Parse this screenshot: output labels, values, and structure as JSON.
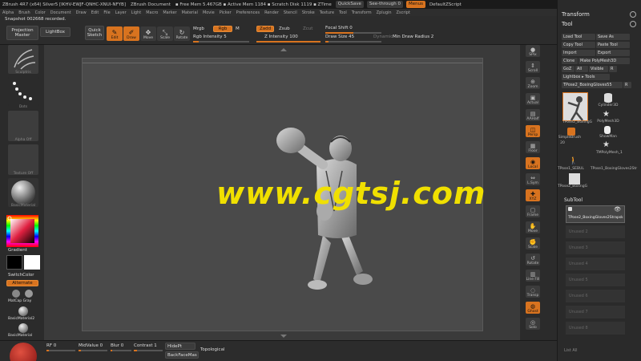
{
  "titlebar": {
    "app": "ZBrush 4R7 (x64) Silver5 [IKHV-EWJF-QNHC-XNUI-NFYB]",
    "doc": "ZBrush Document",
    "mem": "▪ Free Mem 5.467GB ▪ Active Mem 1184 ▪ Scratch Disk 1119 ▪ ZTime",
    "quicksave": "QuickSave",
    "seethrough": "See-through  0",
    "menus": "Menus",
    "script": "DefaultZScript"
  },
  "menu": [
    "Alpha",
    "Brush",
    "Color",
    "Document",
    "Draw",
    "Edit",
    "File",
    "Layer",
    "Light",
    "Macro",
    "Marker",
    "Material",
    "Movie",
    "Picker",
    "Preferences",
    "Render",
    "Stencil",
    "Stroke",
    "Texture",
    "Tool",
    "Transform",
    "Zplugin",
    "Zscript"
  ],
  "topshelf": {
    "note": "Snapshot 002668 recorded.",
    "projection": "Projection Master",
    "lightbox": "LightBox",
    "quicksketch": "Quick Sketch",
    "tools": [
      {
        "label": "Edit",
        "icon": "✎",
        "active": true
      },
      {
        "label": "Draw",
        "icon": "✐",
        "active": true
      },
      {
        "label": "Move",
        "icon": "✥",
        "active": false
      },
      {
        "label": "Scale",
        "icon": "⤡",
        "active": false
      },
      {
        "label": "Rotate",
        "icon": "↻",
        "active": false
      }
    ],
    "mrgb": "Mrgb",
    "rgb": "Rgb",
    "m": "M",
    "rgb_intensity": "Rgb Intensity 5",
    "zadd": "Zadd",
    "zsub": "Zsub",
    "zcut": "Zcut",
    "z_intensity": "Z Intensity 100",
    "focal_shift": "Focal Shift 0",
    "draw_size": "Draw Size 45",
    "dynamic": "Dynamic",
    "min_draw_radius": "Min Draw Radius 2"
  },
  "leftpanel": {
    "brush": "Sculptris",
    "stroke": "Dots",
    "alpha": "Alpha Off",
    "texture": "Texture Off",
    "material": "BasicMaterial",
    "gradient": "Gradient",
    "switchcolor": "SwitchColor",
    "alternate": "Alternate",
    "matcap": "MatCap Gray",
    "basicmat2": "BasicMaterial2",
    "basicmat": "BasicMaterial"
  },
  "bottombar": {
    "rf": "RF 0",
    "midvalue": "MidValue 0",
    "blur": "Blur 0",
    "contrast": "Contrast 1",
    "hidept": "HidePt",
    "backfacemas": "BackFaceMas",
    "topological": "Topological"
  },
  "righttools": [
    {
      "label": "SPix",
      "icon": "●",
      "active": false
    },
    {
      "label": "Scroll",
      "icon": "⇕",
      "active": false
    },
    {
      "label": "Zoom",
      "icon": "⊕",
      "active": false
    },
    {
      "label": "Actual",
      "icon": "▣",
      "active": false
    },
    {
      "label": "AAHalf",
      "icon": "▤",
      "active": false
    },
    {
      "label": "Persp",
      "icon": "◫",
      "active": true
    },
    {
      "label": "Floor",
      "icon": "▦",
      "active": false
    },
    {
      "label": "Local",
      "icon": "◉",
      "active": true
    },
    {
      "label": "L.Sym",
      "icon": "⇔",
      "active": false
    },
    {
      "label": "XYZ",
      "icon": "✚",
      "active": true
    },
    {
      "label": "Frame",
      "icon": "▢",
      "active": false
    },
    {
      "label": "Move",
      "icon": "✋",
      "active": false
    },
    {
      "label": "Scale",
      "icon": "✊",
      "active": false
    },
    {
      "label": "Rotate",
      "icon": "↺",
      "active": false
    },
    {
      "label": "Line Fill",
      "icon": "▥",
      "active": false
    },
    {
      "label": "Transp",
      "icon": "◌",
      "active": false
    },
    {
      "label": "Ghost",
      "icon": "◍",
      "active": true
    },
    {
      "label": "Solo",
      "icon": "◎",
      "active": false
    }
  ],
  "rightpanel": {
    "transform": "Transform",
    "tool": "Tool",
    "buttons": [
      [
        "Load Tool",
        "Save As"
      ],
      [
        "Copy Tool",
        "Paste Tool"
      ],
      [
        "Import",
        "Export"
      ],
      [
        "Clone",
        "Make PolyMesh3D"
      ],
      [
        "GoZ",
        "All",
        "Visible",
        "R"
      ]
    ],
    "lightbox_tools": "Lightbox ▸ Tools",
    "current_tool": "TPose2_BoxingGloves55",
    "current_r": "R",
    "grid": [
      {
        "label": "TPose2_BoxingG",
        "num": ""
      },
      {
        "label": "Cylinder3D",
        "num": ""
      },
      {
        "label": "SimpleBrush",
        "num": "20"
      },
      {
        "label": "PolyMesh3D",
        "num": ""
      },
      {
        "label": "ShowMan",
        "num": ""
      },
      {
        "label": "TPose1_SEBUL",
        "num": "20"
      },
      {
        "label": "TPose1_BoxingGloves2Str",
        "num": ""
      },
      {
        "label": "TPose2_BoxingG",
        "num": ""
      },
      {
        "label": "TMPolyMesh_1",
        "num": ""
      }
    ],
    "subtool": "SubTool",
    "subtool_active": "TPose2_BoxingGloves2Strapsk",
    "subtool_items": [
      "Unused 2",
      "Unused 3",
      "Unused 4",
      "Unused 5",
      "Unused 6",
      "Unused 7",
      "Unused 8"
    ],
    "list_all": "List All"
  },
  "canvas": {
    "watermark": "www.cgtsj.com"
  }
}
